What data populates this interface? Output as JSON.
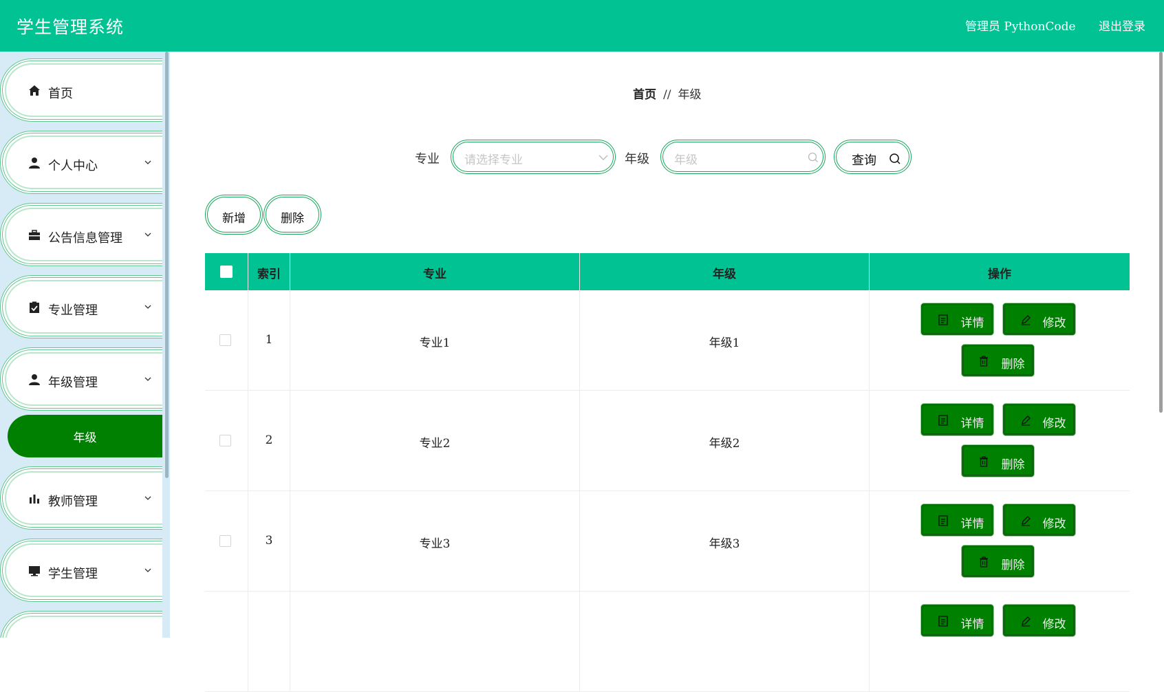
{
  "header": {
    "title": "学生管理系统",
    "admin": "管理员 PythonCode",
    "logout": "退出登录"
  },
  "sidebar": {
    "items": [
      {
        "label": "首页",
        "icon": "home-icon"
      },
      {
        "label": "个人中心",
        "icon": "user-icon"
      },
      {
        "label": "公告信息管理",
        "icon": "briefcase-icon"
      },
      {
        "label": "专业管理",
        "icon": "clipboard-check-icon"
      },
      {
        "label": "年级管理",
        "icon": "user-icon"
      },
      {
        "label": "教师管理",
        "icon": "bar-chart-icon"
      },
      {
        "label": "学生管理",
        "icon": "monitor-icon"
      }
    ],
    "active_sub": "年级"
  },
  "breadcrumb": {
    "home": "首页",
    "separator": "//",
    "current": "年级"
  },
  "search": {
    "major_label": "专业",
    "major_placeholder": "请选择专业",
    "grade_label": "年级",
    "grade_placeholder": "年级",
    "query_label": "查询"
  },
  "actions": {
    "add": "新增",
    "delete": "删除"
  },
  "table": {
    "headers": [
      "索引",
      "专业",
      "年级",
      "操作"
    ],
    "rows": [
      {
        "index": "1",
        "major": "专业1",
        "grade": "年级1"
      },
      {
        "index": "2",
        "major": "专业2",
        "grade": "年级2"
      },
      {
        "index": "3",
        "major": "专业3",
        "grade": "年级3"
      }
    ],
    "buttons": {
      "detail": "详情",
      "edit": "修改",
      "delete": "删除"
    }
  },
  "colors": {
    "primary": "#00c292",
    "active": "#008000",
    "sidebar_bg": "#d6ebf5"
  }
}
